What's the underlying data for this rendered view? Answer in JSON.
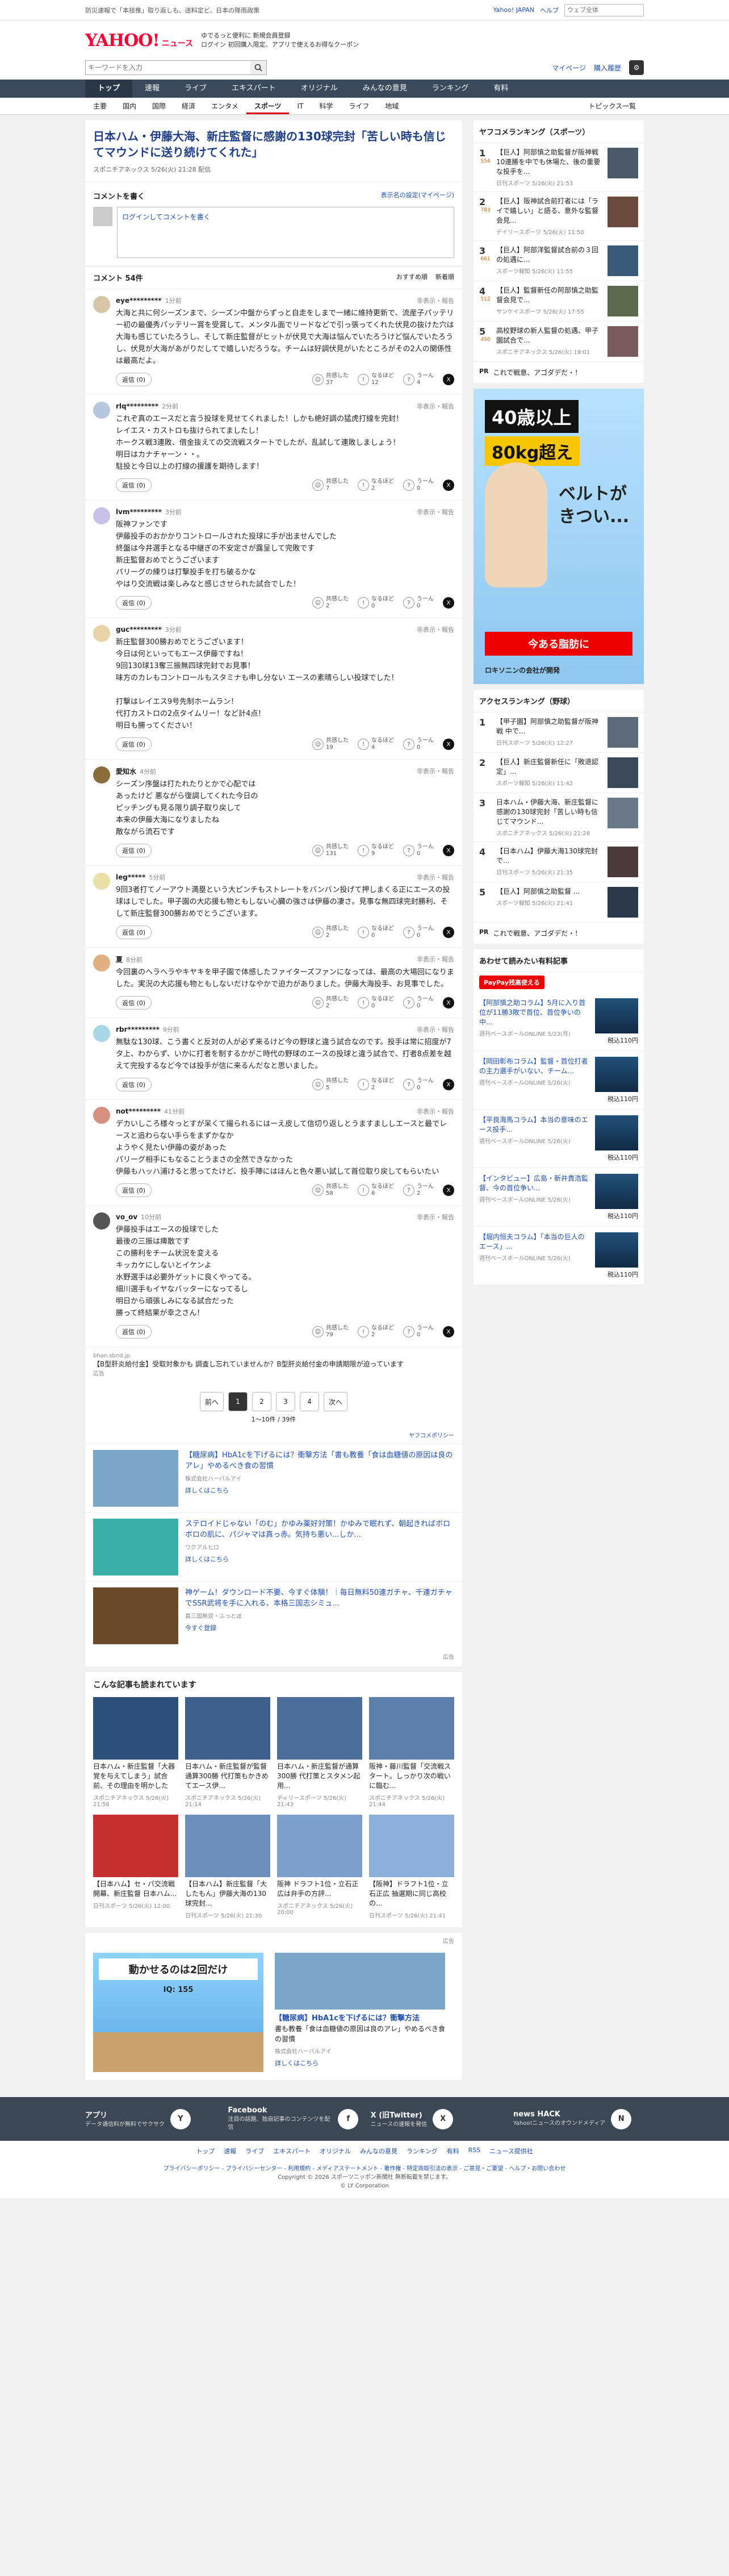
{
  "topbar": {
    "notice": "防災速報で「本技推」取り返しも、送料定ど、日本の降雨政策",
    "links": [
      "Yahoo! JAPAN",
      "ヘルプ"
    ],
    "search_placeholder": "ウェブ全体"
  },
  "masthead": {
    "logo": "YAHOO!",
    "logo_sub": "ニュース",
    "line1": "ゆでるっと便利に 新規会員登録",
    "line2": "ログイン 初回購入限定、アプリで使えるお得なクーポン",
    "search_placeholder": "キーワードを入力",
    "mypage": "マイページ",
    "purchase": "購入履歴"
  },
  "nav1": [
    "トップ",
    "速報",
    "ライブ",
    "エキスパート",
    "オリジナル",
    "みんなの意見",
    "ランキング",
    "有料"
  ],
  "nav2": [
    "主要",
    "国内",
    "国際",
    "経済",
    "エンタメ",
    "スポーツ",
    "IT",
    "科学",
    "ライフ",
    "地域"
  ],
  "nav2_extra": "トピックス一覧",
  "article": {
    "title": "日本ハム・伊藤大海、新庄監督に感謝の130球完封「苦しい時も信じてマウンドに送り続けてくれた」",
    "meta": "スポニチアネックス 5/26(火) 21:28 配信"
  },
  "comment_form": {
    "title": "コメントを書く",
    "settings_link": "表示名の設定(マイページ)",
    "prompt": "ログインしてコメントを書く"
  },
  "comments_bar": {
    "count": "コメント 54件",
    "sort": [
      "おすすめ順",
      "新着順"
    ]
  },
  "reply_label": "返信 (0)",
  "report_label": "非表示・報告",
  "react_labels": [
    "共感した",
    "なるほど",
    "うーん"
  ],
  "comments": [
    {
      "user": "eye*********",
      "time": "1分前",
      "text": "大海と共に何シーズンまで、シーズン中盤からずっと自走をしまで一緒に維持更新で、流産子パッテリー初の最優秀パッテリー賞を受賞して、メンタル面でリードなどで引っ張ってくれた伏見の抜けた穴は大海も感じていたろうし、そして新庄監督がヒットが伏見で大海は悩んでいたろうけど悩んでいたろうし、伏見が大海があがりだしてで嬉しいだろうな。チームは好調伏見がいたところがその2人の関係性は最高だよ。",
      "counts": [
        37,
        12,
        4
      ],
      "color": "#d6c5a8"
    },
    {
      "user": "rlq*********",
      "time": "2分前",
      "text": "これぞ真のエースだと言う投球を見せてくれました！しかも絶好調の猛虎打線を完封！\nレイエス・カストロも抜けられてましたし！\nホークス戦3連敗、借金抜えての交流戦スタートでしたが、乱試して連敗しましょう！\n明日はカナチャーン・・。\n駐投と今日以上の打線の援護を期待します！",
      "counts": [
        7,
        2,
        0
      ],
      "color": "#b8c7e0"
    },
    {
      "user": "lvm*********",
      "time": "3分前",
      "text": "阪神ファンです\n伊藤投手のおかかりコントロールされた投球に手が出ませんでした\n終盤は今井選手となる中継ぎの不安定さが露呈して完敗です\n新庄監督おめでとうございます\nパリーグの練りは打撃投手を打ち破るかな\nやはり交流戦は楽しみなと感じさせられた試合でした！",
      "counts": [
        2,
        0,
        0
      ],
      "color": "#c9c0e8"
    },
    {
      "user": "guc*********",
      "time": "3分前",
      "text": "新庄監督300勝おめでとうございます！\n今日は何といってもエース伊藤ですね！\n9回130球13奪三振無四球完封でお見事！\n味方のカレもコントロールもスタミナも申し分ない エースの素晴らしい投球でした！\n\n打撃はレイエス9号先制ホームラン！\n代打カストロの2点タイムリー！など計4点！\n明日も勝ってください！",
      "counts": [
        19,
        4,
        0
      ],
      "color": "#e8d3a8"
    },
    {
      "user": "愛知水",
      "time": "4分前",
      "text": "シーズン序盤は打たれたりとかで心配では\nあったけど 悪ながら復調してくれた今日の\nピッチングも見る限り調子取り戻して\n本来の伊藤大海になりましたね\n敵ながら流石です",
      "counts": [
        131,
        9,
        0
      ],
      "color": "#8a6d3b"
    },
    {
      "user": "leg*****",
      "time": "5分前",
      "text": "9回3者打てノーアウト満塁という大ピンチもストレートをバンバン投げて押しまくる正にエースの投球はしでした。甲子園の大応援も物ともしない心臓の強さは伊藤の凄さ。見事な無四球完封勝利、そして新庄監督300勝おめでとうございます。",
      "counts": [
        2,
        0,
        0
      ],
      "color": "#e8e0a8"
    },
    {
      "user": "夏",
      "time": "8分前",
      "text": "今回裏のヘラヘラやキヤキを甲子園で体感したファイターズファンになっては、最高の大場回になりました。実況の大応援も物ともしないだけなやかで迫力がありました。伊藤大海投手、お見事でした。",
      "counts": [
        2,
        0,
        0
      ],
      "color": "#e0b080"
    },
    {
      "user": "rbr*********",
      "time": "9分前",
      "text": "無駄な130球、こう書くと反対の人が必ず来るけど今の野球と違う試合なのです。投手は常に招度が7タ上、わからず、いかに打者を制するかがこ時代の野球のエースの投球と違う試合で、打者8点差を越えて完投するなど今では投手が信に来るんだなと思いました。",
      "counts": [
        5,
        2,
        0
      ],
      "color": "#a8d8e8"
    },
    {
      "user": "not*********",
      "time": "41分前",
      "text": "デカいしころ様々っとすが呆くて撮られるにはーえ皮して信切り返しとうますまししエースと最でレースと追わらない手らをまずかなか\nようやく見たい伊藤の姿があった\nパリーグ相手にもなることうまさの全然できなかった\n伊藤もハッハ浦けると思ってたけど、投手陣にはほんと色々悪い試して首位取り戻してもらいたい",
      "counts": [
        58,
        6,
        2
      ],
      "color": "#d89080"
    },
    {
      "user": "vo_ov",
      "time": "10分前",
      "text": "伊藤投手はエースの投球でした\n最後の三振は痺散です\nこの勝利をチーム状況を変える\nキッカケにしないとイケンよ\n水野選手は必要外ゲットに良くやってる。\n細川選手もイヤなバッターになってるし\n明日から頑張しみになる試合だった\n勝って終結果が幸之さん！",
      "counts": [
        79,
        2,
        0
      ],
      "color": "#555555"
    }
  ],
  "ad_inline": {
    "source": "bhan.sbnd.jp",
    "text": "【B型肝炎給付金】受取対象かも 調査し忘れていませんか？B型肝炎給付金の申請期限が迫っています",
    "label": "広告"
  },
  "pager": {
    "prev": "前へ",
    "pages": [
      "1",
      "2",
      "3",
      "4"
    ],
    "next": "次へ",
    "info": "1〜10件 / 39件"
  },
  "policy_link": "ヤフコメポリシー",
  "promos": [
    {
      "title": "【糖尿病】HbA1cを下げるには？衝撃方法「書も教養「食は血糖値の原因は良のアレ」やめるべき食の習慣",
      "src": "株式会社ハーバルアイ",
      "link": "詳しくはこちら",
      "color": "#7aa7c7"
    },
    {
      "title": "ステロイドじゃない「のむ」かゆみ薬好対策！かゆみで眠れず、朝起きればボロボロの肌に、パジャマは真っ赤。気持ち悪い...しか...",
      "src": "ワクアルヒロ",
      "link": "詳しくはこちら",
      "color": "#3ab0a8"
    },
    {
      "title": "神ゲーム！ダウンロード不要、今すぐ体験！｜毎日無料50連ガチャ、千連ガチャでSSR武将を手に入れる、本格三国志シミュ...",
      "src": "真三国無双・ふっとぼ",
      "link": "今すぐ登録",
      "color": "#6a4a2a"
    }
  ],
  "promo_label": "広告",
  "related": {
    "title": "こんな記事も読まれています",
    "items": [
      {
        "title": "日本ハム・新庄監督「大器覚を与えてしまう」試合前、その理由を明かした",
        "src": "スポニチアネックス 5/26(火) 21:56",
        "color": "#2d4f7c"
      },
      {
        "title": "日本ハム・新庄監督が監督通算300勝 代打策もかきめてエース伊...",
        "src": "スポニチアネックス 5/26(火) 21:14",
        "color": "#3d5f8c"
      },
      {
        "title": "日本ハム・新庄監督が通算300勝 代打策とスタメン起用...",
        "src": "ディリースポーツ 5/26(火) 21:43",
        "color": "#4d6f9c"
      },
      {
        "title": "阪神・藤川監督「交流戦スタート。しっかり次の戦いに臨む...",
        "src": "スポニチアネックス 5/26(火) 21:44",
        "color": "#5d7fac"
      },
      {
        "title": "【日本ハム】セ・パ交流戦開幕、新庄監督 日本ハム...",
        "src": "日刊スポーツ 5/26(火) 12:00",
        "color": "#c83030"
      },
      {
        "title": "【日本ハム】新庄監督「大したもん」伊藤大海の130球完封...",
        "src": "日刊スポーツ 5/26(火) 21:30",
        "color": "#6d8fbc"
      },
      {
        "title": "阪神 ドラフト1位・立石正広は弁手の方評...",
        "src": "スポニチアネックス 5/26(火) 20:00",
        "color": "#7d9fcc"
      },
      {
        "title": "【阪神】ドラフト1位・立石正広 抽選期に同じ高校の...",
        "src": "日刊スポーツ 5/26(火) 21:41",
        "color": "#8dafdc"
      }
    ]
  },
  "bottom_ads": {
    "label": "広告",
    "left_title": "動かせるのは2回だけ",
    "left_sub": "IQ: 155",
    "right_title": "【糖尿病】HbA1cを下げるには？衝撃方法",
    "right_text": "書も教養「食は血糖値の原因は良のアレ」やめるべき食の習慣",
    "right_src": "株式会社ハーバルアイ",
    "right_link": "詳しくはこちら"
  },
  "side_ranking": {
    "title": "ヤフコメランキング（スポーツ）",
    "items": [
      {
        "n": "1",
        "cnt": "554",
        "title": "【巨人】阿部慎之助監督が阪神戦 10連勝を中でも休場た、後の重要な投手を...",
        "src": "日刊スポーツ 5/26(火) 21:53"
      },
      {
        "n": "2",
        "cnt": "783",
        "title": "【巨人】阪神試合前打者には「ライで嬉しい」と語る、意外な監督会見...",
        "src": "デイリースポーツ 5/26(火) 11:50"
      },
      {
        "n": "3",
        "cnt": "661",
        "title": "【巨人】阿部洋監督試合前の３回の処遇に...",
        "src": "スポーツ報知 5/26(火) 11:55"
      },
      {
        "n": "4",
        "cnt": "512",
        "title": "【巨人】監督新任の阿部慎之助監督会見で...",
        "src": "サンケイスポーツ 5/26(火) 17:55"
      },
      {
        "n": "5",
        "cnt": "450",
        "title": "高校野球の新人監督の処遇、甲子園試合で...",
        "src": "スポニチアネックス 5/26(火) 19:01"
      }
    ],
    "pr_tag": "PR",
    "pr_text": "これで戦意、アゴダデだ・！"
  },
  "big_ad": {
    "line1": "40歳以上",
    "line2": "80kg超え",
    "line3": "ベルトがきつい...",
    "line4": "今ある脂肪に",
    "line5": "ロキソニンの会社が開発"
  },
  "side_access": {
    "title": "アクセスランキング（野球）",
    "items": [
      {
        "n": "1",
        "title": "【甲子園】阿部慎之助監督が阪神戦 中で...",
        "src": "日刊スポーツ 5/26(火) 12:27"
      },
      {
        "n": "2",
        "title": "【巨人】新庄監督新任に「敗退認定」...",
        "src": "スポーツ報知 5/26(火) 11:42"
      },
      {
        "n": "3",
        "title": "日本ハム・伊藤大海、新庄監督に感謝の130球完封「苦しい時も信じてマウンド...",
        "src": "スポニチアネックス 5/26(火) 21:28"
      },
      {
        "n": "4",
        "title": "【日本ハム】伊藤大海130球完封で...",
        "src": "日刊スポーツ 5/26(火) 21:35"
      },
      {
        "n": "5",
        "title": "【巨人】阿部慎之助監督 ...",
        "src": "スポーツ報知 5/26(火) 21:41"
      }
    ],
    "pr_tag": "PR",
    "pr_text": "これで戦意、アゴダデだ・！"
  },
  "side_shop": {
    "title": "あわせて読みたい有料記事",
    "paypay": "PayPay残高使える",
    "items": [
      {
        "title": "【阿部慎之助コラム】5月に入り首位が11勝3敗で首位、首位争いの中...",
        "src": "週刊ベースボールONLINE 5/23(月)",
        "price": "税込110円"
      },
      {
        "title": "【岡田彰布コラム】監督・首位打者の主力選手がいない、チーム...",
        "src": "週刊ベースボールONLINE 5/26(火)",
        "price": "税込110円"
      },
      {
        "title": "【平良海馬コラム】本当の意味のエース投手...",
        "src": "週刊ベースボールONLINE 5/26(火)",
        "price": "税込110円"
      },
      {
        "title": "【インタビュー】広島・新井貴浩監督、今の首位争い...",
        "src": "週刊ベースボールONLINE 5/26(火)",
        "price": "税込110円"
      },
      {
        "title": "【堀内恒夫コラム】「本当の巨人のエース」...",
        "src": "週刊ベースボールONLINE 5/26(火)",
        "price": "税込110円"
      }
    ]
  },
  "footer": {
    "items": [
      {
        "title": "アプリ",
        "desc": "データ通信料が無料でサクサク",
        "icon": "Y"
      },
      {
        "title": "Facebook",
        "desc": "注目の話題、独自記事のコンテンツを配信",
        "icon": "f"
      },
      {
        "title": "X (旧Twitter)",
        "desc": "ニュースの速報を発信",
        "icon": "X"
      },
      {
        "title": "news HACK",
        "desc": "Yahoo!ニュースのオウンドメディア",
        "icon": "N"
      }
    ],
    "links": [
      "トップ",
      "速報",
      "ライブ",
      "エキスパート",
      "オリジナル",
      "みんなの意見",
      "ランキング",
      "有料",
      "RSS",
      "ニュース提供社"
    ],
    "legal": "プライバシーポリシー - プライバシーセンター - 利用規約 - メディアステートメント - 著作権 - 特定商取引法の表示 - ご意見・ご要望 - ヘルプ・お問い合わせ",
    "copyright": "Copyright © 2026 スポーツニッポン新聞社 無断転載を禁じます。",
    "copyright2": "© LY Corporation"
  }
}
